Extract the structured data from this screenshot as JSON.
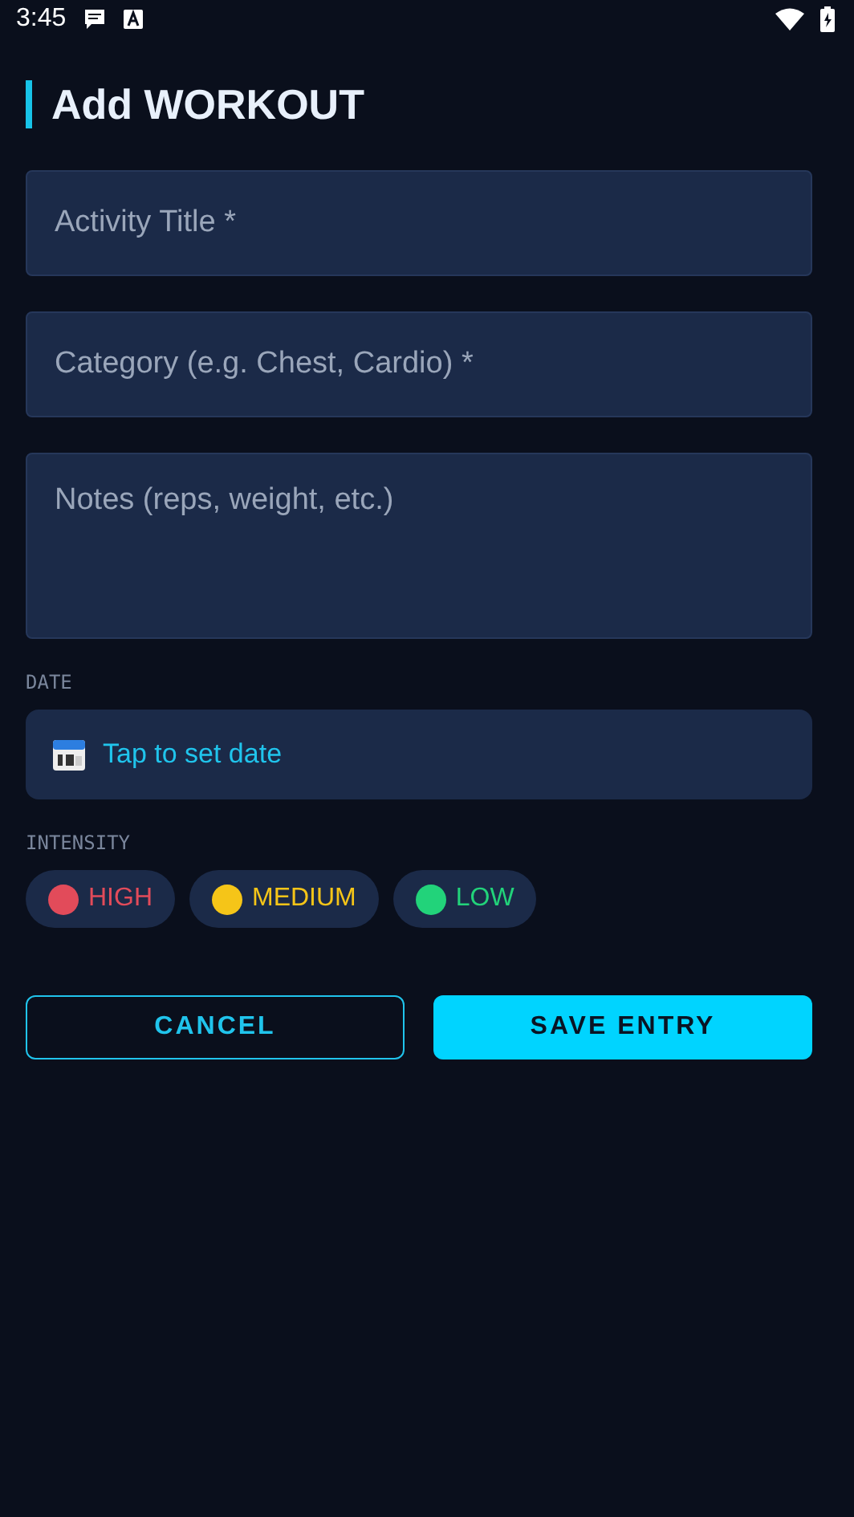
{
  "status_bar": {
    "time": "3:45"
  },
  "title": "Add WORKOUT",
  "fields": [
    {
      "kind": "single",
      "placeholder": "Activity Title *"
    },
    {
      "kind": "single",
      "placeholder": "Category (e.g. Chest, Cardio) *"
    },
    {
      "kind": "multiline",
      "placeholder": "Notes (reps, weight, etc.)"
    }
  ],
  "date": {
    "label": "DATE",
    "value": "Tap to set date"
  },
  "intensity": {
    "label": "INTENSITY",
    "options": [
      {
        "label": "HIGH",
        "color": "#e24b5a"
      },
      {
        "label": "MEDIUM",
        "color": "#f5c518"
      },
      {
        "label": "LOW",
        "color": "#22d37a"
      }
    ]
  },
  "buttons": [
    {
      "label": "CANCEL",
      "kind": "outline"
    },
    {
      "label": "SAVE ENTRY",
      "kind": "filled"
    }
  ]
}
